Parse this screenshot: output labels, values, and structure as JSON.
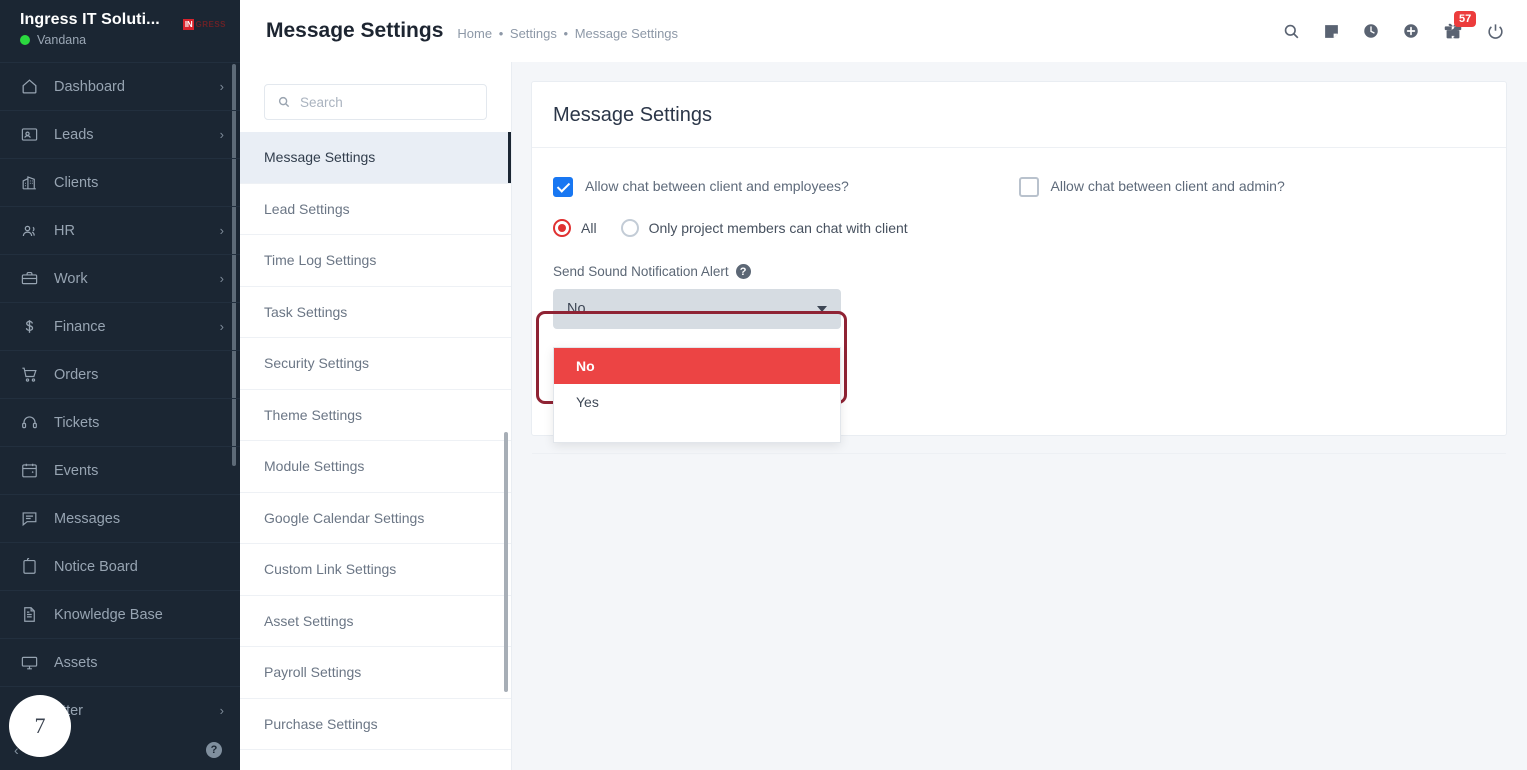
{
  "brand": {
    "company": "Ingress IT Soluti...",
    "user": "Vandana",
    "logo_mark": "IN",
    "logo_text": "GRESS"
  },
  "sidebar": {
    "items": [
      {
        "label": "Dashboard",
        "icon": "home-icon",
        "chevron": "›"
      },
      {
        "label": "Leads",
        "icon": "leads-icon",
        "chevron": "›"
      },
      {
        "label": "Clients",
        "icon": "clients-icon",
        "chevron": ""
      },
      {
        "label": "HR",
        "icon": "hr-icon",
        "chevron": "›"
      },
      {
        "label": "Work",
        "icon": "work-icon",
        "chevron": "›"
      },
      {
        "label": "Finance",
        "icon": "finance-icon",
        "chevron": "›"
      },
      {
        "label": "Orders",
        "icon": "orders-icon",
        "chevron": ""
      },
      {
        "label": "Tickets",
        "icon": "tickets-icon",
        "chevron": ""
      },
      {
        "label": "Events",
        "icon": "events-icon",
        "chevron": ""
      },
      {
        "label": "Messages",
        "icon": "messages-icon",
        "chevron": ""
      },
      {
        "label": "Notice Board",
        "icon": "notice-board-icon",
        "chevron": ""
      },
      {
        "label": "Knowledge Base",
        "icon": "knowledge-base-icon",
        "chevron": ""
      },
      {
        "label": "Assets",
        "icon": "assets-icon",
        "chevron": ""
      },
      {
        "label": "etter",
        "icon": "letter-icon",
        "chevron": "›"
      }
    ],
    "footer": {
      "collapse": "‹",
      "help": "?"
    }
  },
  "topbar": {
    "title": "Message Settings",
    "breadcrumb": [
      "Home",
      "Settings",
      "Message Settings"
    ],
    "separator": "•",
    "icons": [
      "search-icon",
      "note-icon",
      "clock-icon",
      "plus-circle-icon",
      "gift-bell-icon",
      "power-icon"
    ],
    "notification_count": "57"
  },
  "settings_panel": {
    "search_placeholder": "Search",
    "search_value": "",
    "items": [
      "Message Settings",
      "Lead Settings",
      "Time Log Settings",
      "Task Settings",
      "Security Settings",
      "Theme Settings",
      "Module Settings",
      "Google Calendar Settings",
      "Custom Link Settings",
      "Asset Settings",
      "Payroll Settings",
      "Purchase Settings"
    ],
    "active_index": 0
  },
  "main": {
    "card_title": "Message Settings",
    "checkbox_employees": {
      "label": "Allow chat between client and employees?",
      "checked": true
    },
    "checkbox_admin": {
      "label": "Allow chat between client and admin?",
      "checked": false
    },
    "radios": [
      {
        "label": "All",
        "selected": true
      },
      {
        "label": "Only project members can chat with client",
        "selected": false
      }
    ],
    "sound_field": {
      "label": "Send Sound Notification Alert",
      "help_icon": "?",
      "value": "No",
      "options": [
        {
          "label": "No",
          "highlighted": true
        },
        {
          "label": "Yes",
          "highlighted": false
        }
      ]
    }
  },
  "cursor": {
    "step": "7"
  },
  "colors": {
    "sidebar_bg": "#1b2633",
    "accent_red": "#ec4444",
    "annotation_red": "#8f2334",
    "checkbox_blue": "#1877f2",
    "radio_red": "#e03131",
    "badge_red": "#ec3c3c"
  }
}
